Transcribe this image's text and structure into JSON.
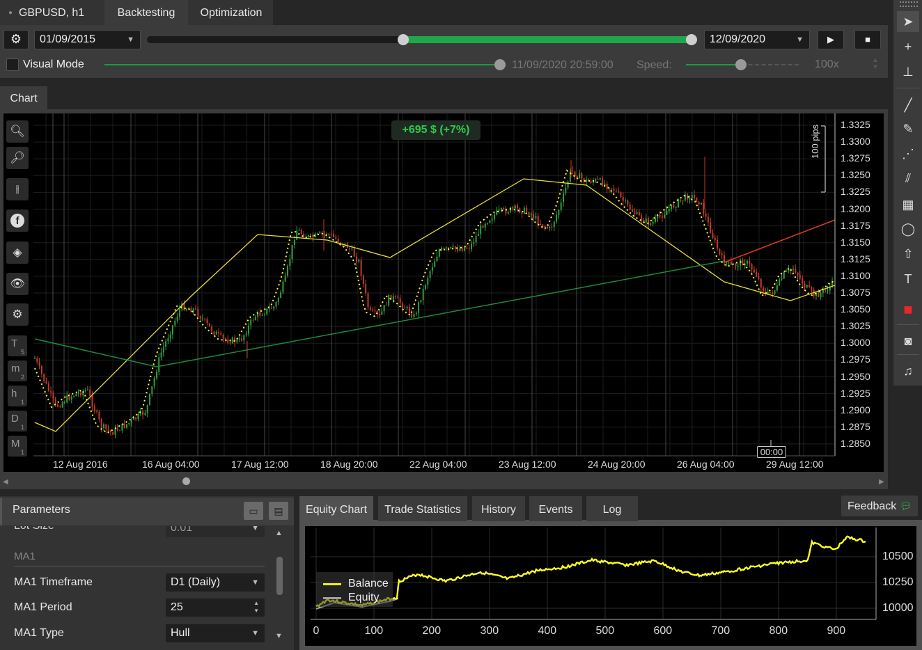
{
  "tabs": {
    "symbol": "GBPUSD, h1",
    "backtesting": "Backtesting",
    "optimization": "Optimization"
  },
  "toolbar": {
    "start_date": "01/09/2015",
    "end_date": "12/09/2020",
    "visual_mode": "Visual Mode",
    "visual_mode_checked": false,
    "current_time": "11/09/2020 20:59:00",
    "speed_label": "Speed:",
    "speed_value": "100x",
    "range_fill": 0.52
  },
  "chart_tab": "Chart",
  "chart": {
    "profit_badge": "+695 $ (+7%)",
    "pips_label": "100 pips",
    "time_marker": "00:00",
    "y_ticks": [
      "1.3325",
      "1.3300",
      "1.3275",
      "1.3250",
      "1.3225",
      "1.3200",
      "1.3175",
      "1.3150",
      "1.3125",
      "1.3100",
      "1.3075",
      "1.3050",
      "1.3025",
      "1.3000",
      "1.2975",
      "1.2950",
      "1.2925",
      "1.2900",
      "1.2875",
      "1.2850"
    ],
    "x_ticks": [
      "12 Aug 2016",
      "16 Aug 04:00",
      "17 Aug 12:00",
      "18 Aug 20:00",
      "22 Aug 04:00",
      "23 Aug 12:00",
      "24 Aug 20:00",
      "26 Aug 04:00",
      "29 Aug 12:00"
    ],
    "left_tools": [
      "zoom-in-icon",
      "zoom-out-icon",
      "indicators-icon",
      "facebook-icon",
      "layers-icon",
      "eye-icon",
      "settings-icon"
    ],
    "timeframes": [
      {
        "label": "T",
        "sub": "5"
      },
      {
        "label": "m",
        "sub": "2"
      },
      {
        "label": "h",
        "sub": "1"
      },
      {
        "label": "D",
        "sub": "1"
      },
      {
        "label": "M",
        "sub": "1"
      }
    ]
  },
  "right_tools": [
    "cursor-icon",
    "crosshair-icon",
    "measure-icon",
    "trendline-icon",
    "pencil-icon",
    "fibonacci-icon",
    "channel-icon",
    "grid-icon",
    "ellipse-icon",
    "arrow-up-icon",
    "text-icon",
    "color-swatch-icon",
    "camera-icon",
    "alert-icon"
  ],
  "right_tools_glyphs": [
    "➤",
    "+",
    "⊥",
    "╱",
    "✎",
    "⋰",
    "⫽",
    "▦",
    "◯",
    "⇧",
    "T",
    "■",
    "◙",
    "♫"
  ],
  "parameters": {
    "title": "Parameters",
    "partial_row": {
      "label": "Lot Size",
      "value": "0.01"
    },
    "section": "MA1",
    "rows": [
      {
        "label": "MA1 Timeframe",
        "value": "D1 (Daily)",
        "control": "dropdown"
      },
      {
        "label": "MA1 Period",
        "value": "25",
        "control": "stepper"
      },
      {
        "label": "MA1 Type",
        "value": "Hull",
        "control": "dropdown"
      }
    ]
  },
  "bottom_tabs": [
    "Equity Chart",
    "Trade Statistics",
    "History",
    "Events",
    "Log"
  ],
  "feedback": "Feedback",
  "equity": {
    "legend": [
      {
        "name": "Balance",
        "color": "#f0f000"
      },
      {
        "name": "Equity",
        "color": "#a0a0a0"
      }
    ],
    "x_ticks": [
      "0",
      "100",
      "200",
      "300",
      "400",
      "500",
      "600",
      "700",
      "800",
      "900"
    ],
    "y_ticks": [
      "10500",
      "10250",
      "10000"
    ]
  }
}
